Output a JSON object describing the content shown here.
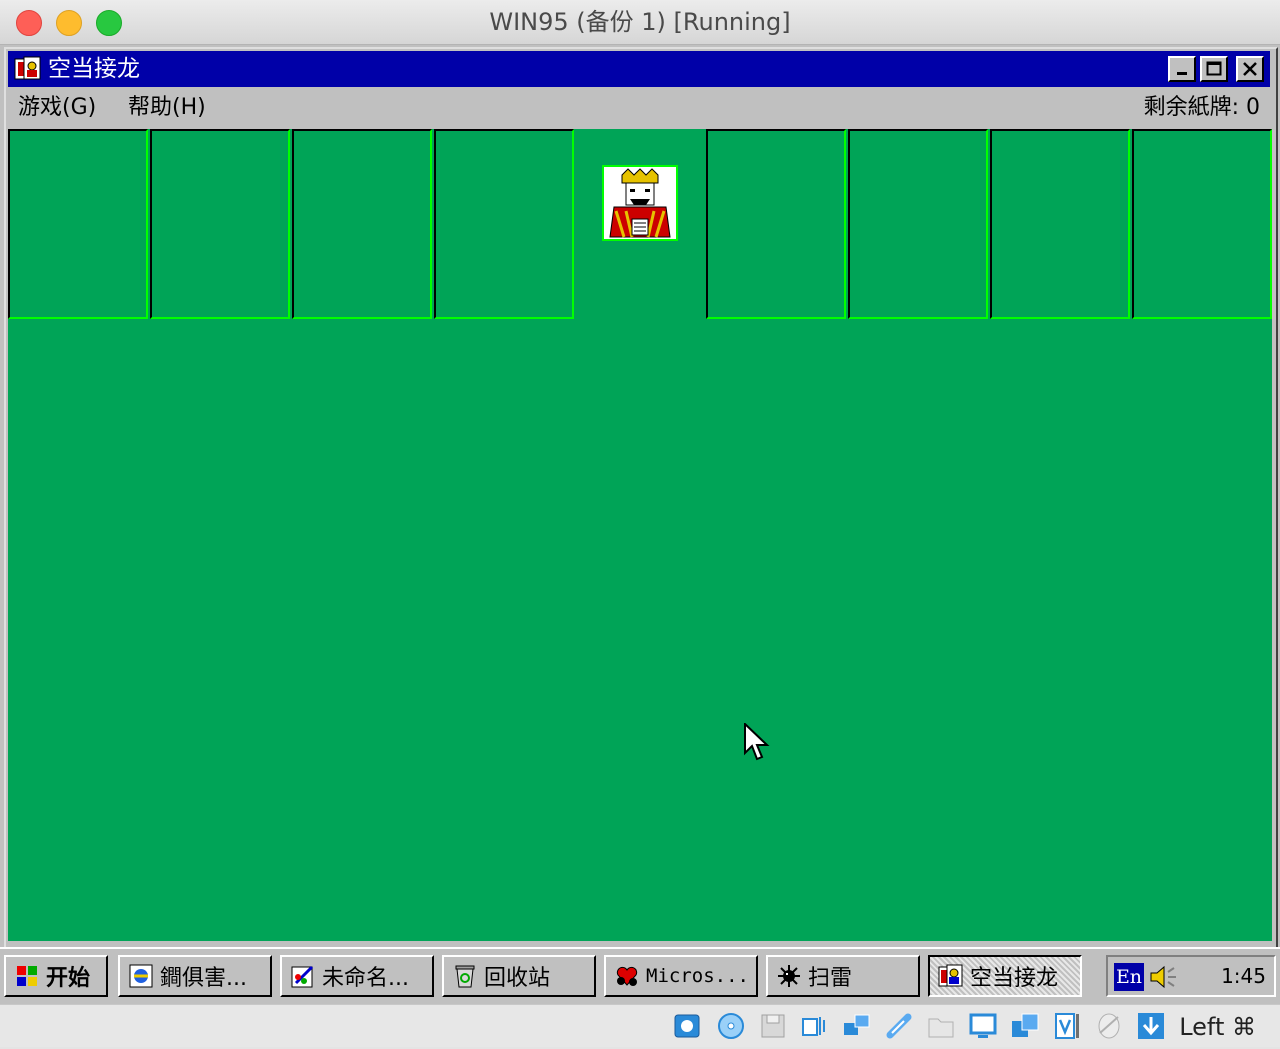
{
  "host": {
    "title": "WIN95 (备份 1) [Running]",
    "buttons": [
      "close",
      "minimize",
      "zoom"
    ],
    "host_key": "Left ⌘"
  },
  "app": {
    "title": "空当接龙",
    "menu": {
      "game": "游戏(G)",
      "help": "帮助(H)"
    },
    "cards_remaining": "剩余紙牌: 0",
    "free_cells": 4,
    "home_cells": 4,
    "center_icon": "king-card-icon"
  },
  "taskbar": {
    "start_label": "开始",
    "items": [
      {
        "label": "鐧俱害...",
        "icon": "ie-icon"
      },
      {
        "label": "未命名...",
        "icon": "paint-icon"
      },
      {
        "label": "回收站",
        "icon": "recycle-bin-icon"
      },
      {
        "label": "Micros...",
        "icon": "hearts-icon"
      },
      {
        "label": "扫雷",
        "icon": "minesweeper-icon"
      },
      {
        "label": "空当接龙",
        "icon": "freecell-icon",
        "active": true
      }
    ],
    "ime": "En",
    "clock": "1:45"
  },
  "colors": {
    "felt": "#00a457",
    "titlebar": "#0000a8",
    "slot_highlight": "#00ff00"
  }
}
